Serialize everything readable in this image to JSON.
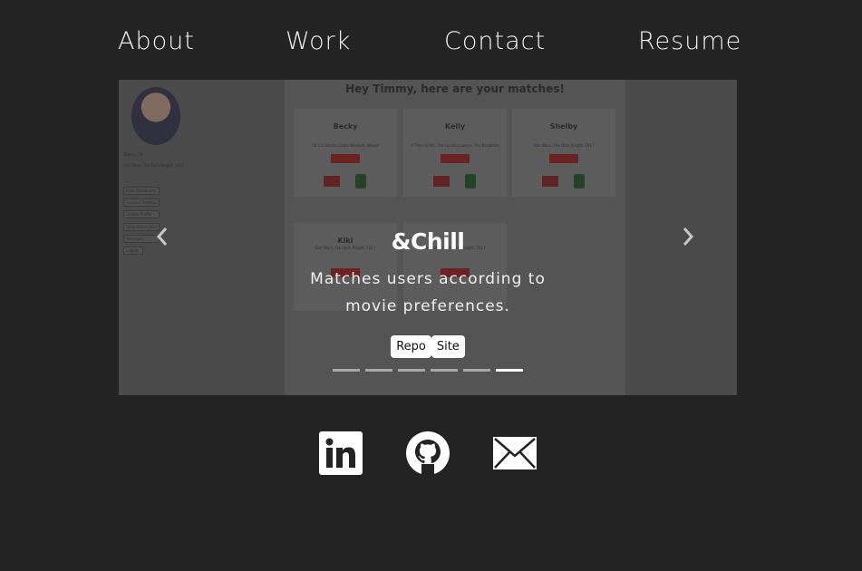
{
  "nav": {
    "about": "About",
    "work": "Work",
    "contact": "Contact",
    "resume": "Resume"
  },
  "slide": {
    "screenshot": {
      "title": "Hey Timmy, here are your matches!",
      "profile_name": "Timmy, 29",
      "profile_movies": "Star Wars, The Dark Knight, 1917",
      "sidebar_buttons": [
        "Main Dashboard",
        "Account Settings",
        "Update Profile",
        "Daily Match Quiz",
        "Messages",
        "Logout"
      ],
      "cards": [
        {
          "name": "Becky",
          "desc": "50 Cal Shorts, Claire Blankets Waves"
        },
        {
          "name": "Kelly",
          "desc": "A Time to Kill, The Lincoln Lawyer, The Breakfast"
        },
        {
          "name": "Shelby",
          "desc": "Star Wars, The Dark Knight, 1917"
        },
        {
          "name": "Kiki",
          "desc": "Star Wars, The Dark Knight, 1917"
        },
        {
          "name": "",
          "desc": "Star Wars, The Dark Knight, 1917"
        }
      ]
    },
    "caption_title": "&Chill",
    "caption_desc": "Matches users according to movie preferences.",
    "repo_label": "Repo",
    "site_label": "Site"
  },
  "carousel": {
    "indicator_count": 6,
    "active_index": 5,
    "prev_icon": "chevron-left-icon",
    "next_icon": "chevron-right-icon"
  },
  "social": {
    "icons": [
      "linkedin-icon",
      "github-icon",
      "mail-icon"
    ]
  },
  "colors": {
    "background": "#232323",
    "text": "#ffffff"
  }
}
